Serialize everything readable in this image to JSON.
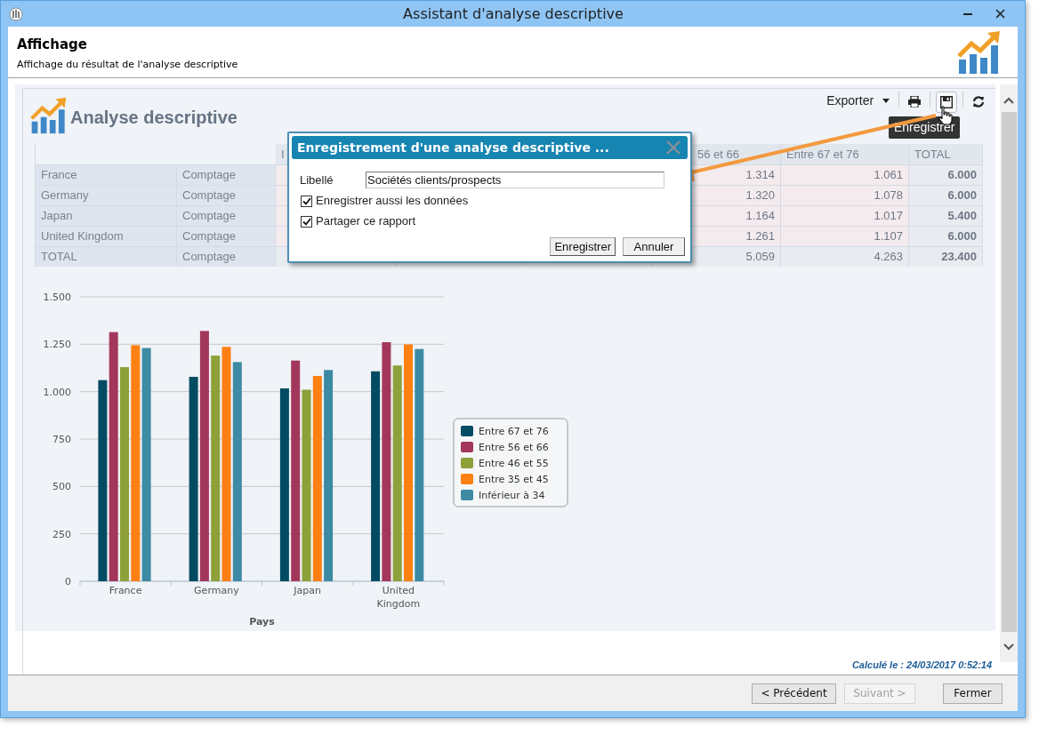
{
  "window": {
    "title": "Assistant d'analyse descriptive"
  },
  "header": {
    "title": "Affichage",
    "subtitle": "Affichage du résultat de l'analyse descriptive"
  },
  "report": {
    "title": "Analyse descriptive",
    "toolbar": {
      "export_label": "Exporter"
    },
    "tooltip": "Enregistrer",
    "table": {
      "column_headers": [
        "I",
        "56 et 66",
        "Entre 67 et 76",
        "TOTAL"
      ],
      "rows": [
        {
          "kind": "data",
          "country": "France",
          "measure": "Comptage",
          "values": [
            "1.314",
            "1.061",
            "6.000"
          ]
        },
        {
          "kind": "data",
          "country": "Germany",
          "measure": "Comptage",
          "values": [
            "1.320",
            "1.078",
            "6.000"
          ]
        },
        {
          "kind": "data",
          "country": "Japan",
          "measure": "Comptage",
          "values": [
            "1.164",
            "1.017",
            "5.400"
          ]
        },
        {
          "kind": "data",
          "country": "United Kingdom",
          "measure": "Comptage",
          "values": [
            "1.261",
            "1.107",
            "6.000"
          ]
        },
        {
          "kind": "total",
          "country": "TOTAL",
          "measure": "Comptage",
          "values": [
            "5.059",
            "4.263",
            "23.400"
          ]
        }
      ]
    },
    "chart_data": {
      "type": "bar",
      "xlabel": "Pays",
      "categories": [
        "France",
        "Germany",
        "Japan",
        "United Kingdom"
      ],
      "series": [
        {
          "name": "Entre 67 et 76",
          "color": "#034b63",
          "values": [
            1061,
            1078,
            1017,
            1107
          ]
        },
        {
          "name": "Entre 56 et 66",
          "color": "#a3375b",
          "values": [
            1314,
            1320,
            1164,
            1261
          ]
        },
        {
          "name": "Entre 46 et 55",
          "color": "#8ea03a",
          "values": [
            1129,
            1190,
            1010,
            1138
          ]
        },
        {
          "name": "Entre 35 et 45",
          "color": "#ff8012",
          "values": [
            1245,
            1236,
            1083,
            1249
          ]
        },
        {
          "name": "Inférieur à 34",
          "color": "#3d8aa4",
          "values": [
            1230,
            1156,
            1114,
            1225
          ]
        }
      ],
      "grid": true,
      "legend": true,
      "ylim": [
        0,
        1500
      ],
      "yticks": [
        {
          "value": 0,
          "label": "0"
        },
        {
          "value": 250,
          "label": "250"
        },
        {
          "value": 500,
          "label": "500"
        },
        {
          "value": 750,
          "label": "750"
        },
        {
          "value": 1000,
          "label": "1.000"
        },
        {
          "value": 1250,
          "label": "1.250"
        },
        {
          "value": 1500,
          "label": "1.500"
        }
      ]
    }
  },
  "dialog": {
    "title": "Enregistrement d'une analyse descriptive ...",
    "field": {
      "label": "Libellé",
      "value": "Sociétés clients/prospects"
    },
    "checkboxes": [
      {
        "label": "Enregistrer aussi les données",
        "checked": true
      },
      {
        "label": "Partager ce rapport",
        "checked": true
      }
    ],
    "buttons": [
      "Enregistrer",
      "Annuler"
    ]
  },
  "computed_at": "Calculé le : 24/03/2017 0:52:14",
  "footer_buttons": [
    {
      "label": "< Précédent",
      "disabled": false
    },
    {
      "label": "Suivant >",
      "disabled": true
    },
    {
      "label": "Fermer",
      "disabled": false
    }
  ]
}
